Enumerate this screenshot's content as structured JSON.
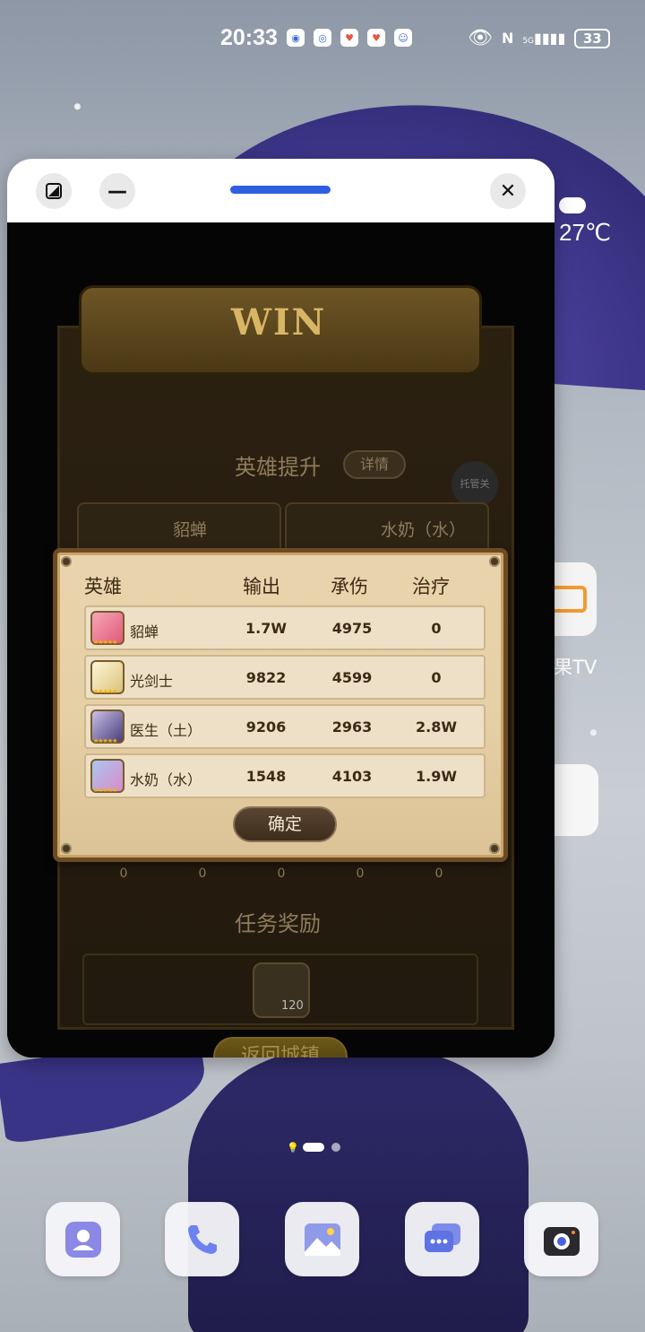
{
  "status_bar": {
    "time": "20:33",
    "battery": "33",
    "network": "5G"
  },
  "weather": {
    "temperature": "27℃"
  },
  "apps": {
    "tv_label": "果TV"
  },
  "game": {
    "win_text": "WIN",
    "hero_upgrade_title": "英雄提升",
    "detail_button": "详情",
    "auto_button": "托管关",
    "hero_cards": [
      "貂蝉",
      "水奶（水）"
    ],
    "zero_values": [
      "0",
      "0",
      "0",
      "0",
      "0"
    ],
    "task_reward_title": "任务奖励",
    "reward_count": "120",
    "return_button": "返回城镇"
  },
  "popup": {
    "headers": {
      "hero": "英雄",
      "damage": "输出",
      "taken": "承伤",
      "heal": "治疗"
    },
    "rows": [
      {
        "name": "貂蝉",
        "damage": "1.7W",
        "taken": "4975",
        "heal": "0"
      },
      {
        "name": "光剑士",
        "damage": "9822",
        "taken": "4599",
        "heal": "0"
      },
      {
        "name": "医生（土）",
        "damage": "9206",
        "taken": "2963",
        "heal": "2.8W"
      },
      {
        "name": "水奶（水）",
        "damage": "1548",
        "taken": "4103",
        "heal": "1.9W"
      }
    ],
    "confirm_button": "确定"
  },
  "colors": {
    "accent_blue": "#2f5fe0",
    "popup_bg": "#e8d4ad",
    "gold": "#d9b666"
  },
  "dock": [
    "contacts-icon",
    "phone-icon",
    "gallery-icon",
    "messages-icon",
    "camera-icon"
  ]
}
